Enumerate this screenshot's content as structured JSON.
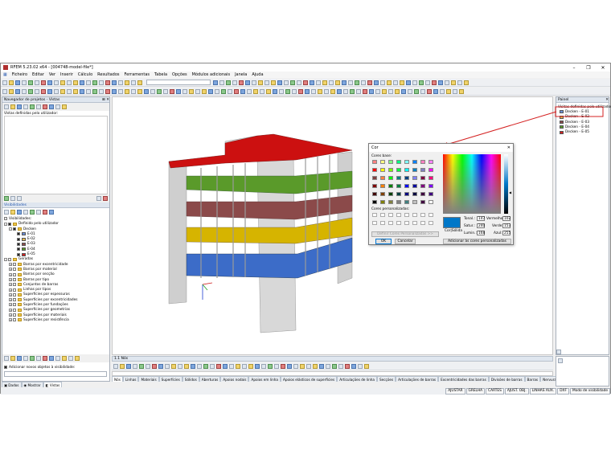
{
  "window": {
    "title": "RFEM 5.23.02 x64 - [004748-model-file*]"
  },
  "menu": [
    "Ficheiro",
    "Editar",
    "Ver",
    "Inserir",
    "Cálculo",
    "Resultados",
    "Ferramentas",
    "Tabela",
    "Opções",
    "Módulos adicionais",
    "Janela",
    "Ajuda"
  ],
  "nav": {
    "title": "Navegador de projetos - Vistas",
    "user_views_label": "Vistas definidas pelo utilizador:",
    "visibility_title": "Visibilidades",
    "visibility_label": "Visibilidades:",
    "user_defined": "Definido pelo utilizador",
    "decken": "Decken",
    "floors": [
      {
        "label": "E-01",
        "color": "#6a8fd8"
      },
      {
        "label": "E-02",
        "color": "#e8b84a"
      },
      {
        "label": "E-03",
        "color": "#8b4a4a"
      },
      {
        "label": "E-04",
        "color": "#5a9a2a"
      },
      {
        "label": "E-05",
        "color": "#d42020"
      }
    ],
    "generated": "Geradas",
    "generated_items": [
      "Barras por excentricidade",
      "Barras por material",
      "Barras por secção",
      "Barras por tipo",
      "Conjuntos de barras",
      "Linhas por tipos",
      "Superfícies por espessuras",
      "Superfícies por excentricidades",
      "Superfícies por fundações",
      "Superfícies por geometrias",
      "Superfícies por materiais",
      "Superfícies por resistência"
    ],
    "add_new_label": "Adicionar novos objetos à visibilidade:",
    "tabs": [
      "Dados",
      "Mostrar",
      "Vistas"
    ]
  },
  "table_bar": {
    "title": "1.1 Nós"
  },
  "bottom_tabs": [
    "Nós",
    "Linhas",
    "Materiais",
    "Superfícies",
    "Sólidos",
    "Aberturas",
    "Apoios nodais",
    "Apoios em linha",
    "Apoios elásticos de superfícies",
    "Articulações de linha",
    "Secções",
    "Articulações de barras",
    "Excentricidades das barras",
    "Divisões de barras",
    "Barras",
    "Nervuras"
  ],
  "status": [
    "AJUSTAR",
    "GRELHA",
    "CARTES",
    "AJUST. OBJ.",
    "LINHAS AUX.",
    "DXF",
    "Modo de visibilidade"
  ],
  "panel": {
    "title": "Painel",
    "subtitle": "Visitas definidas pelo utilizador",
    "items": [
      {
        "label": "Decken - E-01",
        "color": "#6a8fd8"
      },
      {
        "label": "Decken - E-02",
        "color": "#e8b84a"
      },
      {
        "label": "Decken - E-03",
        "color": "#8b4a4a"
      },
      {
        "label": "Decken - E-04",
        "color": "#5a9a2a"
      },
      {
        "label": "Decken - E-05",
        "color": "#d42020"
      }
    ]
  },
  "dialog": {
    "title": "Cor",
    "base_colors_label": "Cores base:",
    "custom_colors_label": "Cores personalizadas:",
    "define_custom_button": "Definir Cores Personalizadas >>",
    "ok_button": "OK",
    "cancel_button": "Cancelar",
    "add_custom_button": "Adicionar às cores personalizadas",
    "solid_color_label": "Cor|Sólida",
    "hue": {
      "label": "Tonal.:",
      "value": "147"
    },
    "sat": {
      "label": "Satur.:",
      "value": "240"
    },
    "lum": {
      "label": "Lumin.:",
      "value": "168"
    },
    "red": {
      "label": "Vermelho:",
      "value": "102"
    },
    "green": {
      "label": "Verde:",
      "value": "153"
    },
    "blue": {
      "label": "Azul:",
      "value": "255"
    },
    "selected_color": "#0077c8",
    "base_colors": [
      "#ff8080",
      "#ffff80",
      "#80ff80",
      "#00ff80",
      "#80ffff",
      "#0080ff",
      "#ff80c0",
      "#ff80ff",
      "#ff0000",
      "#ffff00",
      "#80ff00",
      "#00ff40",
      "#00ffff",
      "#0080c0",
      "#8080c0",
      "#ff00ff",
      "#804040",
      "#ff8040",
      "#00ff00",
      "#008080",
      "#004080",
      "#8080ff",
      "#800040",
      "#ff0080",
      "#800000",
      "#ff8000",
      "#008000",
      "#008040",
      "#0000ff",
      "#0000a0",
      "#800080",
      "#8000ff",
      "#400000",
      "#804000",
      "#004000",
      "#004040",
      "#000080",
      "#000040",
      "#400040",
      "#400080",
      "#000000",
      "#808000",
      "#808040",
      "#808080",
      "#408080",
      "#c0c0c0",
      "#400040",
      "#ffffff"
    ]
  }
}
